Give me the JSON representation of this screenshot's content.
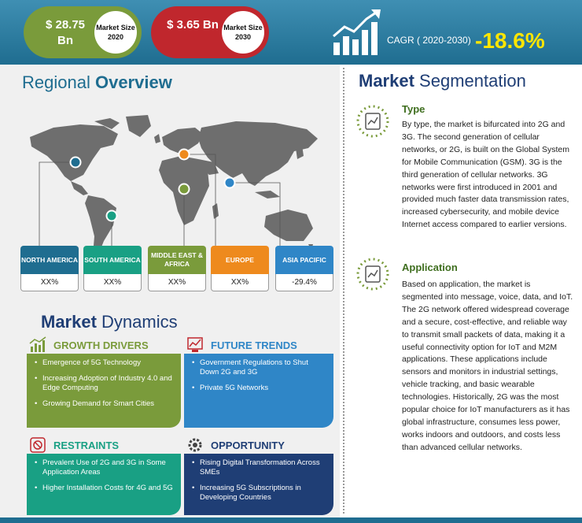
{
  "header": {
    "market_2020_value": "$ 28.75 Bn",
    "market_2020_label": "Market Size 2020",
    "market_2030_value": "$ 3.65 Bn",
    "market_2030_label": "Market Size 2030",
    "cagr_label": "CAGR ( 2020-2030)",
    "cagr_value": "-18.6%"
  },
  "regional": {
    "title_part1": "Regional",
    "title_part2": "Overview",
    "regions": [
      {
        "name": "NORTH AMERICA",
        "value": "XX%",
        "color": "#1f6d90"
      },
      {
        "name": "SOUTH AMERICA",
        "value": "XX%",
        "color": "#19a084"
      },
      {
        "name": "MIDDLE EAST & AFRICA",
        "value": "XX%",
        "color": "#7a9b3b"
      },
      {
        "name": "EUROPE",
        "value": "XX%",
        "color": "#ee8a1d"
      },
      {
        "name": "ASIA PACIFIC",
        "value": "-29.4%",
        "color": "#2f86c7"
      }
    ]
  },
  "dynamics": {
    "title_part1": "Market",
    "title_part2": "Dynamics",
    "growth_drivers": {
      "title": "GROWTH DRIVERS",
      "items": [
        "Emergence of 5G Technology",
        "Increasing Adoption of Industry 4.0 and Edge Computing",
        "Growing Demand for Smart Cities"
      ]
    },
    "future_trends": {
      "title": "FUTURE TRENDS",
      "items": [
        "Government Regulations to Shut Down 2G and 3G",
        "Private 5G Networks"
      ]
    },
    "restraints": {
      "title": "RESTRAINTS",
      "items": [
        "Prevalent Use of 2G and 3G in Some Application Areas",
        "Higher Installation Costs for 4G and 5G"
      ]
    },
    "opportunity": {
      "title": "OPPORTUNITY",
      "items": [
        "Rising Digital Transformation Across SMEs",
        "Increasing 5G Subscriptions in Developing Countries"
      ]
    }
  },
  "segmentation": {
    "title_part1": "Market",
    "title_part2": "Segmentation",
    "type_title": "Type",
    "type_text": "By type, the market is bifurcated into 2G and 3G. The second generation of cellular networks, or 2G, is built on the Global System for Mobile Communication (GSM). 3G is the third generation of cellular networks. 3G networks were first introduced in 2001 and provided much faster data transmission rates, increased cybersecurity, and mobile device Internet access compared to earlier versions.",
    "application_title": "Application",
    "application_text": "Based on application, the market is segmented into message, voice, data, and IoT. The 2G network offered widespread coverage and a secure, cost-effective, and reliable way to transmit small packets of data, making it a useful connectivity option for IoT and M2M applications. These applications include sensors and monitors in industrial settings, vehicle tracking, and basic wearable technologies. Historically, 2G was the most popular choice for IoT manufacturers as it has global infrastructure, consumes less power, works indoors and outdoors, and costs less than advanced cellular networks."
  }
}
